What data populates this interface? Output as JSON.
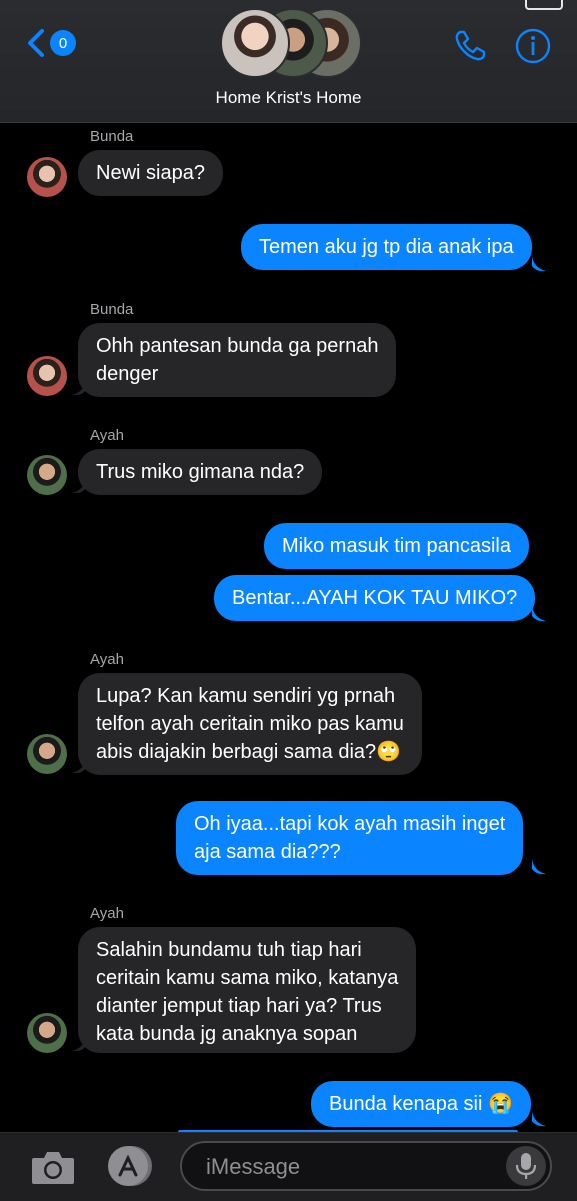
{
  "header": {
    "back_badge": "0",
    "group_name": "Home Krist's Home"
  },
  "messages": [
    {
      "sender": "Bunda",
      "text": "Newi siapa?",
      "dir": "in"
    },
    {
      "text": "Temen aku jg tp dia anak ipa",
      "dir": "out"
    },
    {
      "sender": "Bunda",
      "text": "Ohh pantesan bunda ga pernah\ndenger",
      "dir": "in"
    },
    {
      "sender": "Ayah",
      "text": "Trus miko gimana nda?",
      "dir": "in"
    },
    {
      "text": "Miko masuk tim pancasila",
      "dir": "out"
    },
    {
      "text": "Bentar...AYAH KOK TAU MIKO?",
      "dir": "out"
    },
    {
      "sender": "Ayah",
      "text": "Lupa? Kan kamu sendiri yg prnah\ntelfon ayah ceritain miko pas kamu\nabis diajakin berbagi sama dia?🙄",
      "dir": "in"
    },
    {
      "text": "Oh iyaa...tapi kok ayah masih inget\naja sama dia???",
      "dir": "out"
    },
    {
      "sender": "Ayah",
      "text": "Salahin bundamu tuh tiap hari\nceritain kamu sama miko, katanya\ndianter jemput tiap hari ya? Trus\nkata bunda jg anaknya sopan",
      "dir": "in"
    },
    {
      "text": "Bunda kenapa sii 😭",
      "dir": "out"
    }
  ],
  "composer": {
    "placeholder": "iMessage"
  },
  "colors": {
    "outgoing_bubble": "#0a84ff",
    "incoming_bubble": "#262629",
    "background": "#000000"
  },
  "icons": [
    "back-chevron-icon",
    "phone-icon",
    "info-icon",
    "camera-icon",
    "app-store-icon",
    "microphone-icon"
  ]
}
